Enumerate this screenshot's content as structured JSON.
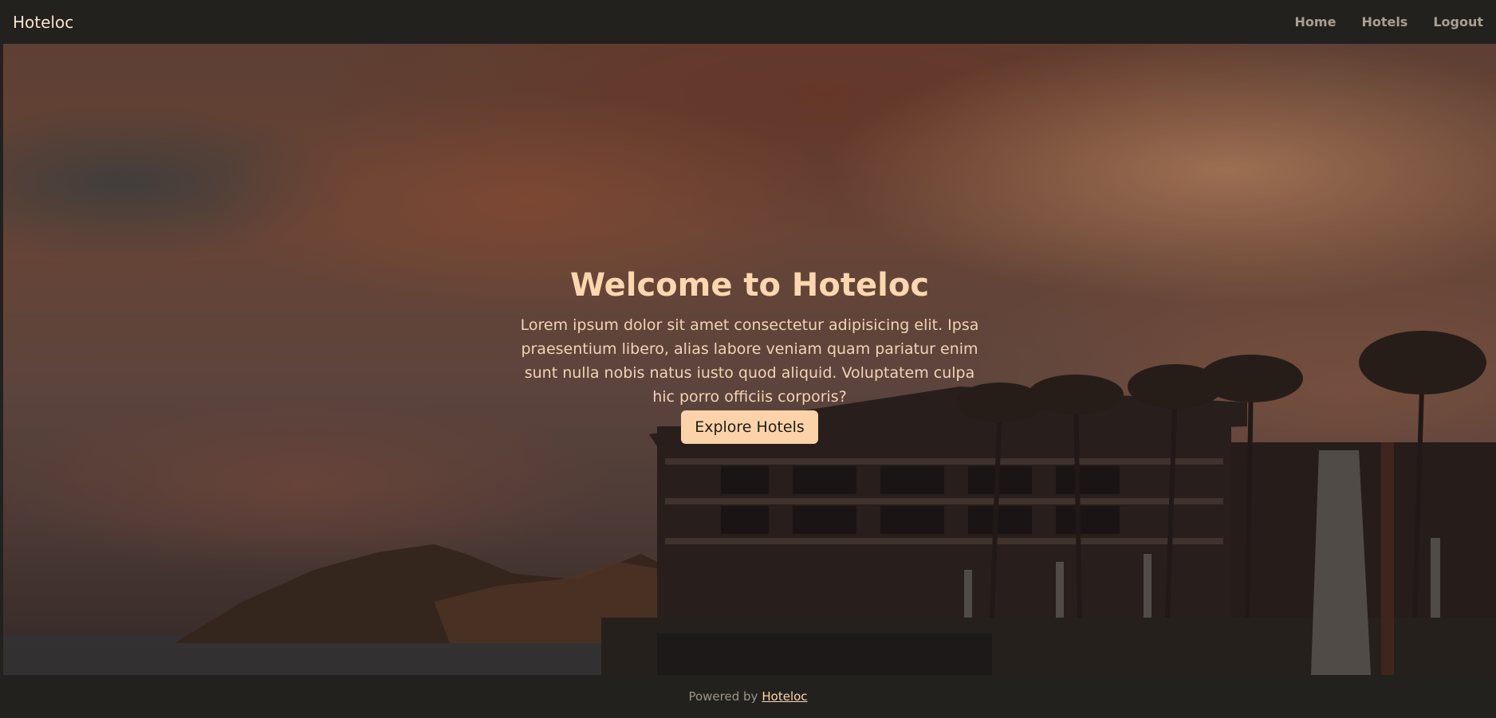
{
  "navbar": {
    "brand": "Hoteloc",
    "links": [
      "Home",
      "Hotels",
      "Logout"
    ]
  },
  "hero": {
    "title": "Welcome to Hoteloc",
    "text": "Lorem ipsum dolor sit amet consectetur adipisicing elit. Ipsa praesentium libero, alias labore veniam quam pariatur enim sunt nulla nobis natus iusto quod aliquid. Voluptatem culpa hic porro officiis corporis?",
    "button_label": "Explore Hotels"
  },
  "footer": {
    "prefix": "Powered by",
    "link_label": "Hoteloc"
  },
  "colors": {
    "nav_bg": "#23211e",
    "accent": "#fcd3a9",
    "title": "#fcd7ae"
  }
}
